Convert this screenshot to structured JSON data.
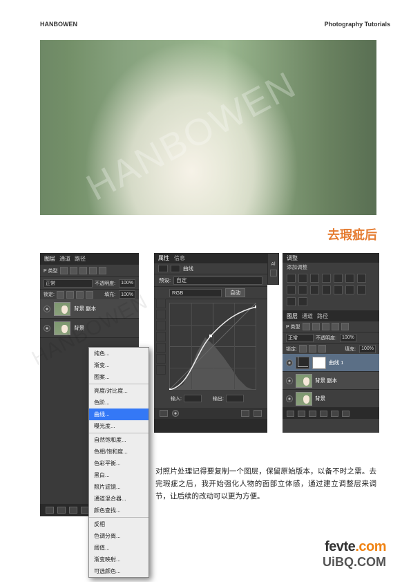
{
  "header": {
    "left": "HANBOWEN",
    "right": "Photography Tutorials"
  },
  "photo": {
    "watermark": "HANBOWEN"
  },
  "section_title": "去瑕疵后",
  "left_panel": {
    "tabs": [
      "图层",
      "通道",
      "路径"
    ],
    "kind_label": "P 类型",
    "kind_small_icons": [
      "a",
      "b",
      "c",
      "d",
      "e"
    ],
    "blend_mode": "正常",
    "opacity_label": "不透明度:",
    "opacity_value": "100%",
    "lock_label": "锁定:",
    "fill_label": "填充:",
    "fill_value": "100%",
    "layers": [
      {
        "name": "背景 副本"
      },
      {
        "name": "背景"
      }
    ],
    "watermark": "HANBOWEN"
  },
  "context_menu": {
    "items": [
      {
        "label": "纯色...",
        "sep": false
      },
      {
        "label": "渐变...",
        "sep": false
      },
      {
        "label": "图案...",
        "sep": false
      },
      {
        "label": "亮度/对比度...",
        "sep": true
      },
      {
        "label": "色阶...",
        "sep": false
      },
      {
        "label": "曲线...",
        "sep": false,
        "hl": true
      },
      {
        "label": "曝光度...",
        "sep": false
      },
      {
        "label": "自然饱和度...",
        "sep": true
      },
      {
        "label": "色相/饱和度...",
        "sep": false
      },
      {
        "label": "色彩平衡...",
        "sep": false
      },
      {
        "label": "黑白...",
        "sep": false
      },
      {
        "label": "照片滤镜...",
        "sep": false
      },
      {
        "label": "通道混合器...",
        "sep": false
      },
      {
        "label": "颜色查找...",
        "sep": false
      },
      {
        "label": "反相",
        "sep": true
      },
      {
        "label": "色调分离...",
        "sep": false
      },
      {
        "label": "阈值...",
        "sep": false
      },
      {
        "label": "渐变映射...",
        "sep": false
      },
      {
        "label": "可选颜色...",
        "sep": false
      }
    ]
  },
  "mid_panel": {
    "tabs": [
      "属性",
      "信息"
    ],
    "kind_label": "曲线",
    "preset_label": "预设:",
    "preset_value": "自定",
    "channel_value": "RGB",
    "auto_btn": "自动",
    "input_label": "输入:",
    "output_label": "输出:",
    "al_tab": "Al"
  },
  "right_panel": {
    "adjust_tab": "调整",
    "add_adjust": "添加调整",
    "tabs": [
      "图层",
      "通道",
      "路径"
    ],
    "kind_label": "P 类型",
    "blend_mode": "正常",
    "opacity_label": "不透明度:",
    "opacity_value": "100%",
    "lock_label": "锁定:",
    "fill_label": "填充:",
    "fill_value": "100%",
    "layers": [
      {
        "name": "曲线 1",
        "adj": true
      },
      {
        "name": "背景 副本",
        "adj": false
      },
      {
        "name": "背景",
        "adj": false
      }
    ]
  },
  "body_text": "对照片处理记得要复制一个图层，保留原始版本，以备不时之需。去完瑕疵之后，我开始强化人物的面部立体感，通过建立调整层来调节，让后续的改动可以更为方便。",
  "footer": {
    "line1a": "fevte",
    "line1b": ".com",
    "line2": "UiBQ.COM"
  }
}
